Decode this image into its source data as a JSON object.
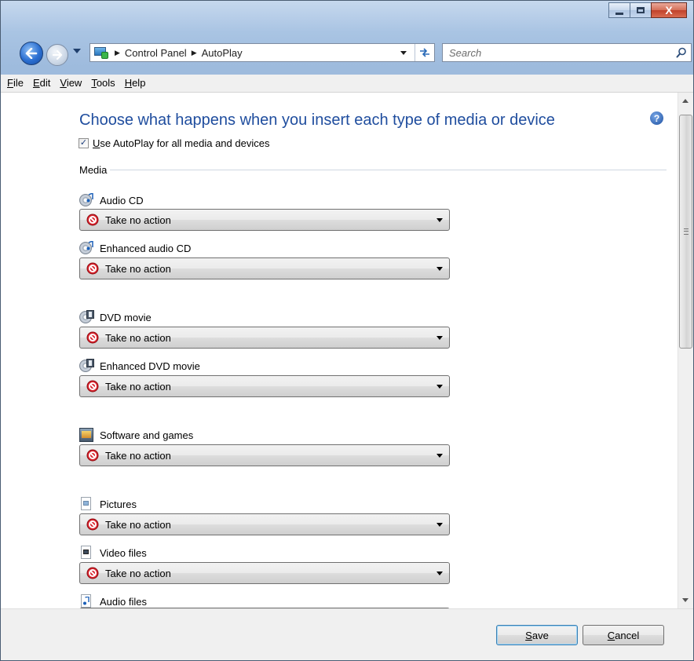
{
  "window": {
    "caption_buttons": {
      "minimize_icon": "minimize-icon",
      "maximize_icon": "maximize-icon",
      "close_glyph": "X"
    }
  },
  "navigation": {
    "breadcrumbs": [
      "Control Panel",
      "AutoPlay"
    ],
    "search": {
      "placeholder": "Search"
    }
  },
  "menu": {
    "items": [
      {
        "accel": "F",
        "rest": "ile"
      },
      {
        "accel": "E",
        "rest": "dit"
      },
      {
        "accel": "V",
        "rest": "iew"
      },
      {
        "accel": "T",
        "rest": "ools"
      },
      {
        "accel": "H",
        "rest": "elp"
      }
    ]
  },
  "content": {
    "title": "Choose what happens when you insert each type of media or device",
    "use_autoplay": {
      "accel": "U",
      "rest": "se AutoPlay for all media and devices",
      "checked": true
    },
    "section_media": "Media",
    "items": [
      {
        "label": "Audio CD",
        "icon": "audio-cd-icon",
        "action": "Take no action"
      },
      {
        "label": "Enhanced audio CD",
        "icon": "enhanced-audio-cd-icon",
        "action": "Take no action"
      },
      {
        "label": "DVD movie",
        "icon": "dvd-movie-icon",
        "action": "Take no action"
      },
      {
        "label": "Enhanced DVD movie",
        "icon": "enhanced-dvd-movie-icon",
        "action": "Take no action"
      },
      {
        "label": "Software and games",
        "icon": "software-games-icon",
        "action": "Take no action"
      },
      {
        "label": "Pictures",
        "icon": "pictures-icon",
        "action": "Take no action"
      },
      {
        "label": "Video files",
        "icon": "video-files-icon",
        "action": "Take no action"
      },
      {
        "label": "Audio files",
        "icon": "audio-files-icon"
      }
    ]
  },
  "buttons": {
    "save": {
      "accel": "S",
      "rest": "ave"
    },
    "cancel": {
      "accel": "C",
      "rest": "ancel"
    }
  },
  "colors": {
    "title_blue": "#1f4d9e",
    "no_action_red": "#d9232d"
  }
}
